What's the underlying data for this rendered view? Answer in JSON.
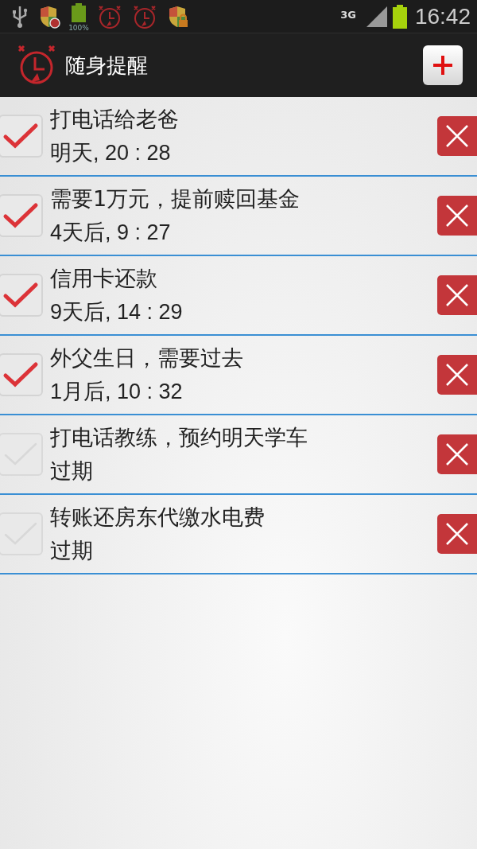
{
  "status_bar": {
    "battery_label": "100%",
    "network": "3G",
    "time": "16:42"
  },
  "header": {
    "title": "随身提醒"
  },
  "reminders": [
    {
      "title": "打电话给老爸",
      "when": "明天, 20 : 28",
      "checked": true
    },
    {
      "title": "需要1万元，提前赎回基金",
      "when": "4天后, 9 : 27",
      "checked": true
    },
    {
      "title": "信用卡还款",
      "when": "9天后, 14 : 29",
      "checked": true
    },
    {
      "title": "外父生日，需要过去",
      "when": "1月后, 10 : 32",
      "checked": true
    },
    {
      "title": "打电话教练，预约明天学车",
      "when": "过期",
      "checked": false
    },
    {
      "title": "转账还房东代缴水电费",
      "when": "过期",
      "checked": false
    }
  ]
}
